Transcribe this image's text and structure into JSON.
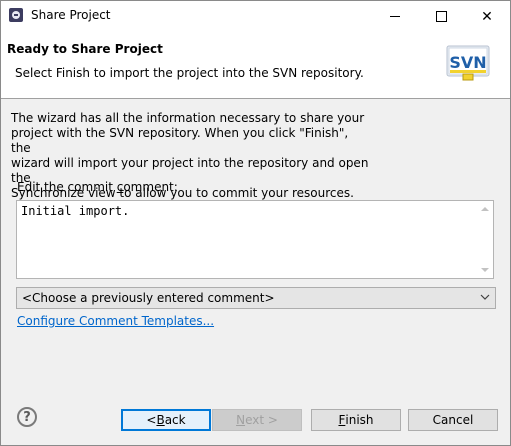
{
  "window": {
    "title": "Share Project"
  },
  "banner": {
    "title": "Ready to Share Project",
    "description": "Select Finish to import the project into the SVN repository.",
    "logo_text": "SVN"
  },
  "body": {
    "info_text": "The wizard has all the information necessary to share your\nproject with the SVN repository. When you click \"Finish\", the\nwizard will import your project into the repository and open the\nSynchronize view to allow you to commit your resources.",
    "commit_label_pre": "Edit the commit ",
    "commit_label_key": "c",
    "commit_label_post": "omment:",
    "commit_value": "Initial import.",
    "previous_comments_selected": "<Choose a previously entered comment>",
    "configure_link": "Configure Comment Templates..."
  },
  "footer": {
    "help_label": "?",
    "back": {
      "pre": "< ",
      "key": "B",
      "post": "ack"
    },
    "next": {
      "pre": "",
      "key": "N",
      "post": "ext >"
    },
    "finish": {
      "pre": "",
      "key": "F",
      "post": "inish"
    },
    "cancel_label": "Cancel"
  },
  "colors": {
    "link": "#0066cc",
    "default_button_border": "#0078d7",
    "logo_yellow": "#f2d22e",
    "logo_blue": "#1f5fa8"
  }
}
